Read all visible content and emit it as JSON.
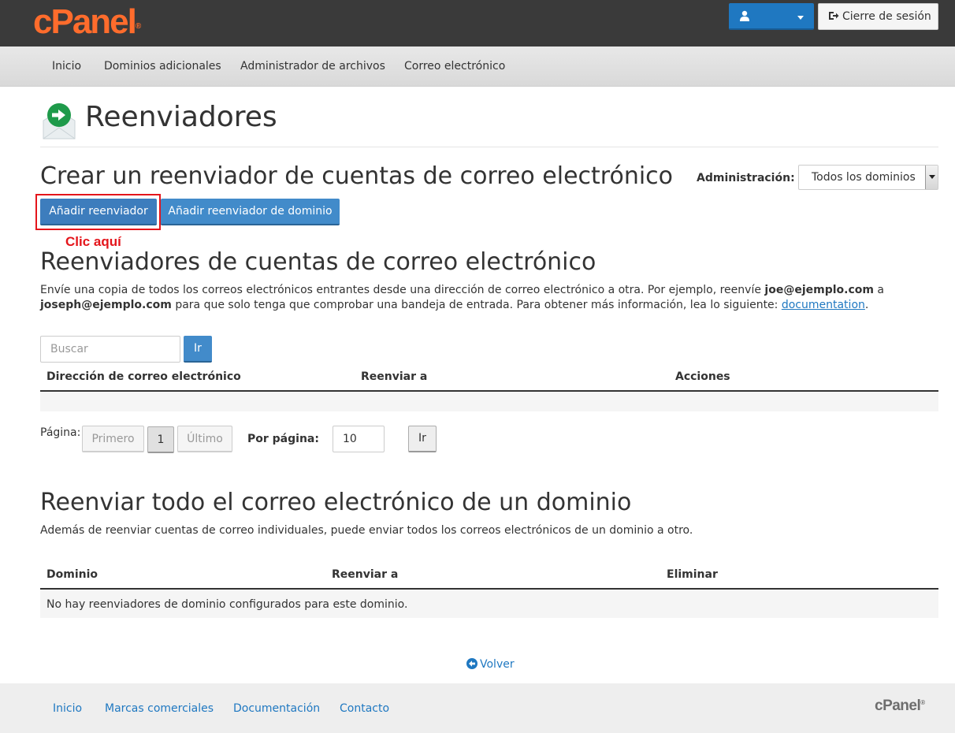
{
  "header": {
    "logo_text": "cPanel",
    "logo_mark": "®",
    "user_icon": "user-icon",
    "logout_label": "Cierre de sesión",
    "logout_icon": "logout-icon"
  },
  "nav": {
    "items": [
      {
        "label": "Inicio"
      },
      {
        "label": "Dominios adicionales"
      },
      {
        "label": "Administrador de archivos"
      },
      {
        "label": "Correo electrónico"
      }
    ]
  },
  "page": {
    "title": "Reenviadores",
    "icon": "forwarder-envelope-icon"
  },
  "create": {
    "heading": "Crear un reenviador de cuentas de correo electrónico",
    "admin_label": "Administración:",
    "admin_selected": "Todos los dominios",
    "add_forwarder_label": "Añadir reenviador",
    "add_domain_forwarder_label": "Añadir reenviador de dominio",
    "annotation": "Clic aquí"
  },
  "account_forwarders": {
    "heading": "Reenviadores de cuentas de correo electrónico",
    "desc_part1": "Envíe una copia de todos los correos electrónicos entrantes desde una dirección de correo electrónico a otra. Por ejemplo, reenvíe ",
    "desc_email1": "joe@ejemplo.com",
    "desc_part2": " a",
    "desc_email2": "joseph@ejemplo.com",
    "desc_part3": " para que solo tenga que comprobar una bandeja de entrada. Para obtener más información, lea lo siguiente: ",
    "desc_link": "documentation",
    "desc_end": ".",
    "search_placeholder": "Buscar",
    "search_go": "Ir",
    "columns": [
      "Dirección de correo electrónico",
      "Reenviar a",
      "Acciones"
    ]
  },
  "pagination": {
    "page_label": "Página:",
    "first": "Primero",
    "current": "1",
    "last": "Último",
    "per_page_label": "Por página:",
    "per_page_value": "10",
    "go": "Ir"
  },
  "domain_forwarders": {
    "heading": "Reenviar todo el correo electrónico de un dominio",
    "desc": "Además de reenviar cuentas de correo individuales, puede enviar todos los correos electrónicos de un dominio a otro.",
    "columns": [
      "Dominio",
      "Reenviar a",
      "Eliminar"
    ],
    "empty_message": "No hay reenviadores de dominio configurados para este dominio."
  },
  "back": {
    "label": "Volver",
    "icon": "back-arrow-icon"
  },
  "footer": {
    "links": [
      {
        "label": "Inicio"
      },
      {
        "label": "Marcas comerciales"
      },
      {
        "label": "Documentación"
      },
      {
        "label": "Contacto"
      }
    ],
    "logo_text": "cPanel",
    "logo_mark": "®"
  },
  "colors": {
    "accent_orange": "#ff6c2c",
    "primary_blue": "#428bca",
    "annotation_red": "#e4151b",
    "topbar": "#3a3a3a"
  }
}
